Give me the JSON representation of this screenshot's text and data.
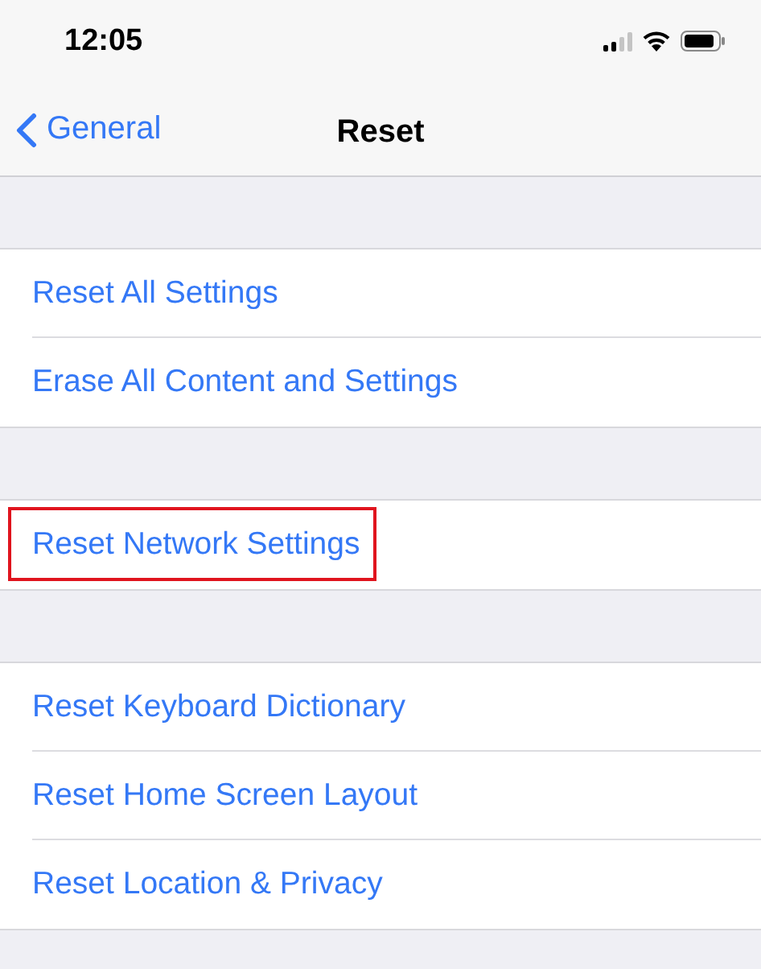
{
  "status_bar": {
    "time": "12:05"
  },
  "nav": {
    "back_label": "General",
    "title": "Reset"
  },
  "groups": [
    {
      "items": [
        {
          "label": "Reset All Settings",
          "highlighted": false
        },
        {
          "label": "Erase All Content and Settings",
          "highlighted": false
        }
      ]
    },
    {
      "items": [
        {
          "label": "Reset Network Settings",
          "highlighted": true
        }
      ]
    },
    {
      "items": [
        {
          "label": "Reset Keyboard Dictionary",
          "highlighted": false
        },
        {
          "label": "Reset Home Screen Layout",
          "highlighted": false
        },
        {
          "label": "Reset Location & Privacy",
          "highlighted": false
        }
      ]
    }
  ]
}
